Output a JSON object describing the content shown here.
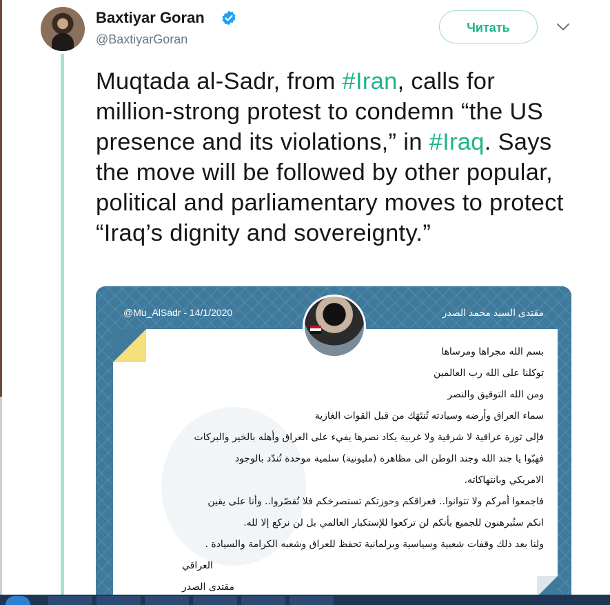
{
  "tweet": {
    "author_name": "Baxtiyar Goran",
    "author_handle": "@BaxtiyarGoran",
    "follow_label": "Читать",
    "text_parts": [
      {
        "t": "Muqtada al-Sadr, from ",
        "tag": false
      },
      {
        "t": "#Iran",
        "tag": true
      },
      {
        "t": ", calls for million-strong protest to condemn “the US presence and its violations,” in ",
        "tag": false
      },
      {
        "t": "#Iraq",
        "tag": true
      },
      {
        "t": ". Says the move will be followed by other popular, political and parliamentary moves to protect “Iraq’s dignity and sovereignty.”",
        "tag": false
      }
    ]
  },
  "media": {
    "handle_date": "@Mu_AlSadr - 14/1/2020",
    "name": "مقتدى السيد محمد الصدر",
    "lines": [
      "بسم الله مجراها ومرساها",
      "توكلنا على الله رب العالمين",
      "ومن الله التوفيق والنصر",
      "سماء العراق وأرضه وسيادته تُنتَهَك من قبل القوات الغازية",
      "فإلى ثورة عراقية لا شرقية ولا غربية يكاد نصرها يفيء على العراق وأهله بالخير والبركات",
      "فهبّوا يا جند الله وجند الوطن الى مظاهرة (مليونية) سلمية موحدة تُندّد بالوجود",
      "الامريكي وبانتهاكاته.",
      "فاجمعوا أمركم ولا تتوانوا.. فعراقكم وحوزتكم تستصرخكم فلا تُقصّروا.. وأنا على يقين",
      "انكم ستُبرهنون للجميع بأنكم لن تركعوا للإستكبار العالمي بل لن نركع إلا لله.",
      "ولنا بعد ذلك وقفات شعبية وسياسية وبرلمانية تحفظ للعراق وشعبه الكرامة والسيادة ."
    ],
    "signature": [
      "العراقي",
      "مقتدى الصدر"
    ]
  },
  "colors": {
    "accent": "#1db38a",
    "thread": "#a6e3d1",
    "card": "#3f7a9d"
  },
  "icons": {
    "verified": "verified-badge-icon",
    "caret": "chevron-down-icon"
  }
}
